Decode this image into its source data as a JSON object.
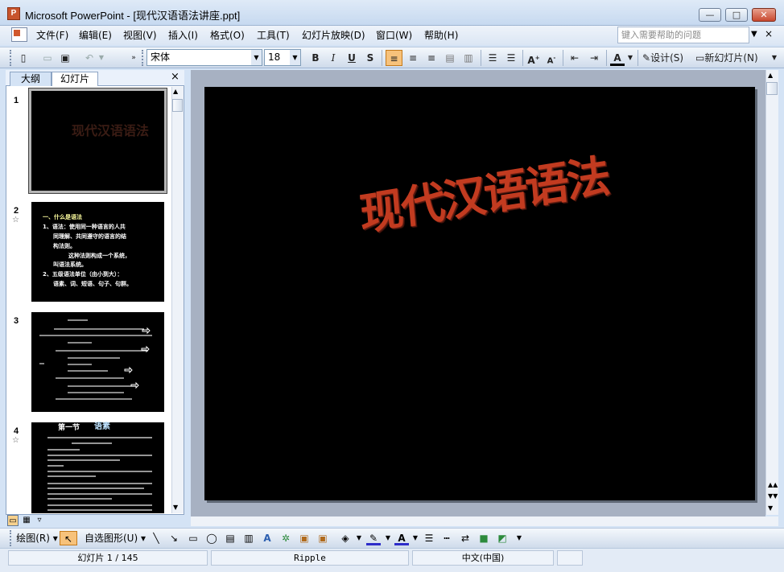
{
  "window": {
    "title": "Microsoft PowerPoint - [现代汉语语法讲座.ppt]",
    "app_icon": "P",
    "minimize": "—",
    "maximize": "□",
    "close": "✕"
  },
  "menu": {
    "items": [
      "文件(F)",
      "编辑(E)",
      "视图(V)",
      "插入(I)",
      "格式(O)",
      "工具(T)",
      "幻灯片放映(D)",
      "窗口(W)",
      "帮助(H)"
    ],
    "help_placeholder": "键入需要帮助的问题"
  },
  "toolbar": {
    "font": "宋体",
    "size": "18",
    "bold": "B",
    "italic": "I",
    "underline": "U",
    "shadow": "S",
    "design": "设计(S)",
    "new_slide": "新幻灯片(N)"
  },
  "pane": {
    "tab_outline": "大纲",
    "tab_slides": "幻灯片",
    "close": "×"
  },
  "slides": [
    {
      "num": "1",
      "title": "现代汉语语法"
    },
    {
      "num": "2",
      "star": "☆",
      "lines": [
        "一、什么是语法",
        "1、语法：使用同一种语言的人共",
        "同理解、共同遵守的语言的结",
        "构法则。",
        "这种法则构成一个系统，",
        "叫语法系统。",
        "2、五级语法单位（由小到大）：",
        "语素、词、短语、句子、句群。"
      ]
    },
    {
      "num": "3"
    },
    {
      "num": "4",
      "star": "☆",
      "heading_a": "第一节",
      "heading_b": "语素"
    }
  ],
  "main_slide": {
    "title": "现代汉语语法"
  },
  "drawbar": {
    "draw": "绘图(R)",
    "autoshape": "自选图形(U)"
  },
  "status": {
    "slide_counter": "幻灯片 1 / 145",
    "design": "Ripple",
    "language": "中文(中国)"
  }
}
